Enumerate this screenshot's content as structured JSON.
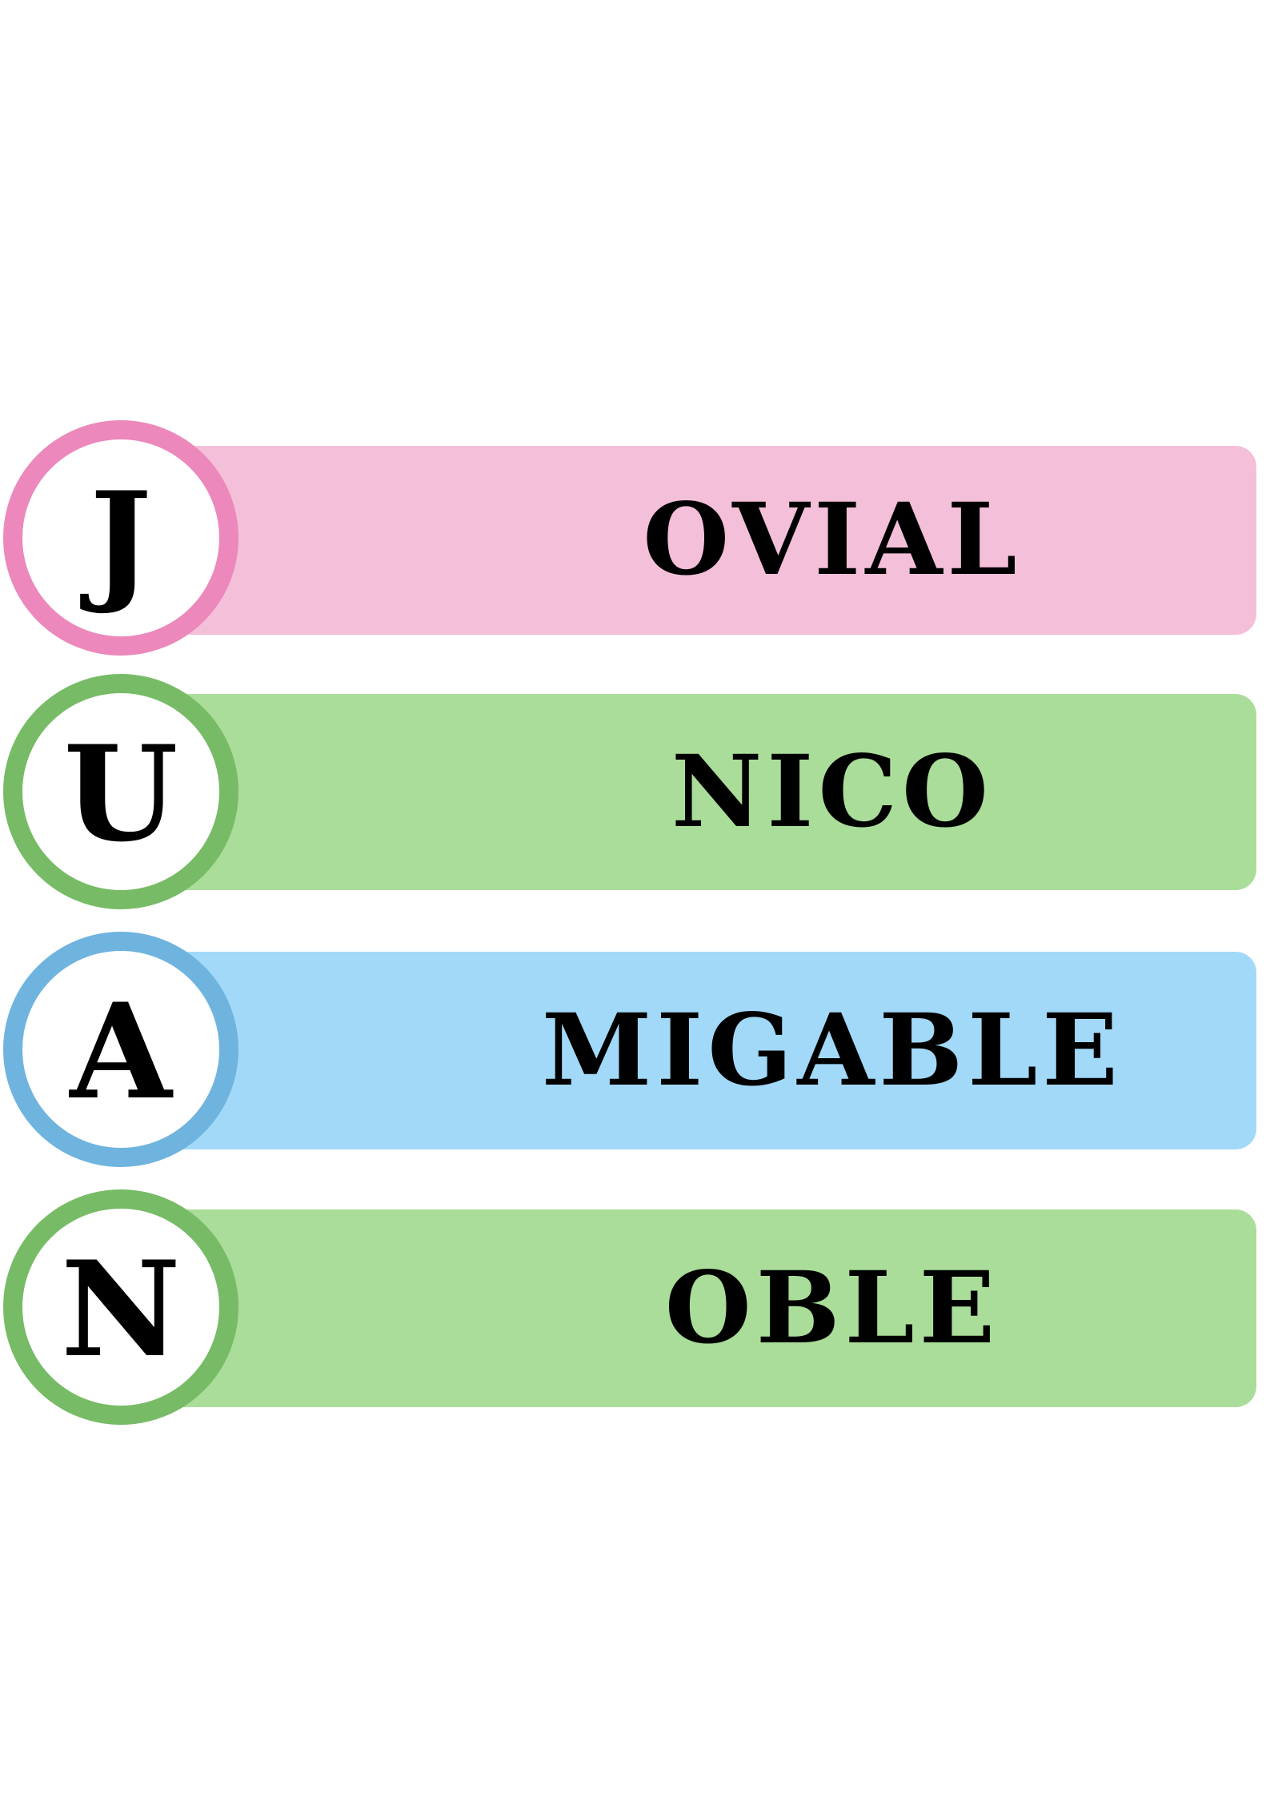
{
  "rows": [
    {
      "letter": "J",
      "word": "OVIAL",
      "bar_color": "#f4bfd9",
      "ring_color": "#ec88bb"
    },
    {
      "letter": "U",
      "word": "NICO",
      "bar_color": "#aadd99",
      "ring_color": "#77bb66"
    },
    {
      "letter": "A",
      "word": "MIGABLE",
      "bar_color": "#a2d9f8",
      "ring_color": "#6fb4de"
    },
    {
      "letter": "N",
      "word": "OBLE",
      "bar_color": "#aadd99",
      "ring_color": "#77bb66"
    }
  ]
}
